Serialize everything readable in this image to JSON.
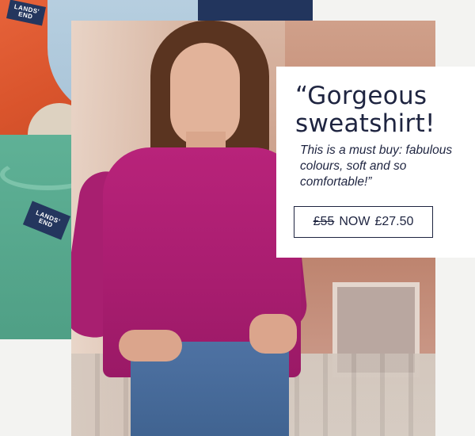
{
  "brand": {
    "label_lines": [
      "LANDS'",
      "END"
    ],
    "colors": {
      "navy": "#1e2440",
      "magenta_sweatshirt": "#b8237a",
      "background": "#f3f3f1"
    }
  },
  "quote": {
    "title_line1": "“Gorgeous",
    "title_line2": "sweatshirt!",
    "body": "This is a must buy: fabulous colours, soft and so comfortable!”"
  },
  "price": {
    "old": "£55",
    "now_label": "NOW",
    "new": "£27.50"
  }
}
